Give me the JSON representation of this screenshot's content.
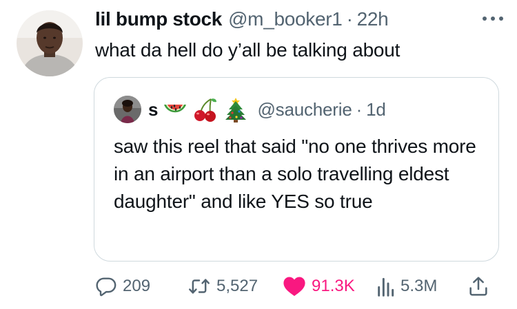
{
  "tweet": {
    "display_name": "lil bump stock",
    "handle": "@m_booker1",
    "separator": "·",
    "time": "22h",
    "text": "what da hell do y’all be talking about"
  },
  "quoted_tweet": {
    "display_name": "s",
    "emojis": [
      "watermelon",
      "cherries",
      "christmas-tree"
    ],
    "handle": "@saucherie",
    "separator": "·",
    "time": "1d",
    "text": "saw this reel that said \"no one thrives more in an airport than a solo travelling eldest daughter\" and like YES so true"
  },
  "actions": {
    "replies": "209",
    "reposts": "5,527",
    "likes": "91.3K",
    "views": "5.3M"
  },
  "colors": {
    "text": "#0f1419",
    "secondary": "#536471",
    "like_active": "#f91880",
    "border": "#cfd9de"
  },
  "icons": {
    "more": "more-icon",
    "reply": "reply-icon",
    "repost": "repost-icon",
    "like": "heart-icon",
    "views": "views-icon",
    "share": "share-icon"
  }
}
